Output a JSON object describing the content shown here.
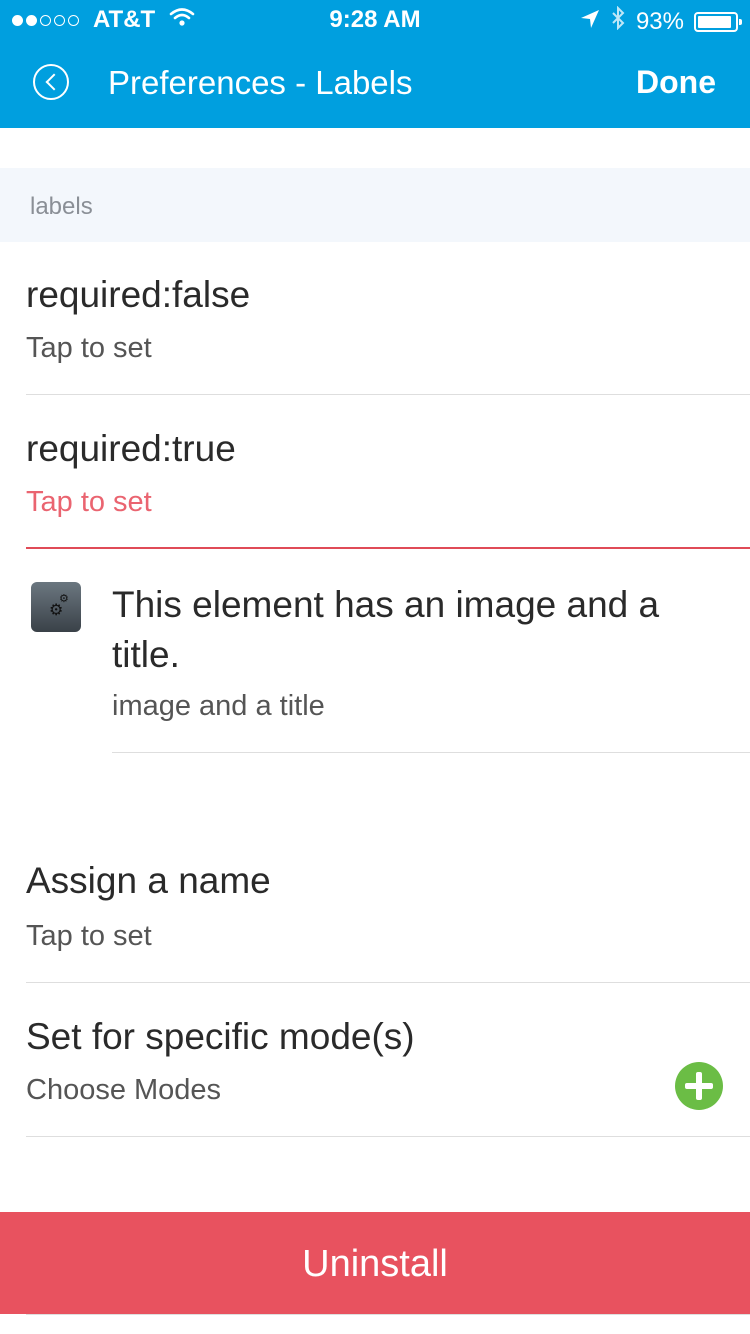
{
  "status_bar": {
    "carrier": "AT&T",
    "time": "9:28 AM",
    "battery_percent_text": "93%",
    "battery_level": 0.93,
    "signal_bars_filled": 2,
    "signal_bars_total": 5
  },
  "nav": {
    "title": "Preferences - Labels",
    "done_label": "Done"
  },
  "section": {
    "header": "labels"
  },
  "rows": {
    "required_false": {
      "title": "required:false",
      "subtitle": "Tap to set"
    },
    "required_true": {
      "title": "required:true",
      "subtitle": "Tap to set"
    },
    "image_element": {
      "title": "This element has an image and a title.",
      "subtitle": "image and a title"
    },
    "assign_name": {
      "title": "Assign a name",
      "subtitle": "Tap to set"
    },
    "modes": {
      "title": "Set for specific mode(s)",
      "subtitle": "Choose Modes"
    }
  },
  "uninstall_label": "Uninstall",
  "colors": {
    "header_bg": "#009fdf",
    "accent_red": "#e8525f",
    "add_green": "#6bbd45"
  }
}
